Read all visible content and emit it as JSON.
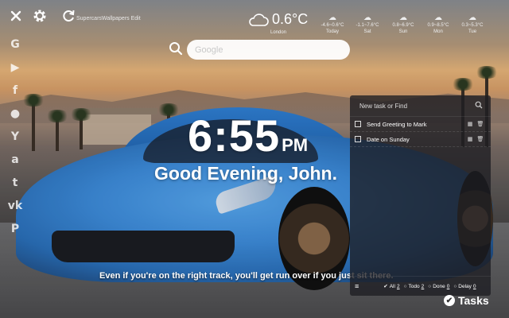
{
  "topbar": {
    "brand_text": "SupercarsWallpapers Edit"
  },
  "weather": {
    "current_temp": "0.6°C",
    "location": "London",
    "forecast": [
      {
        "range": "-4.6~0.6°C",
        "day": "Today"
      },
      {
        "range": "-1.1~7.6°C",
        "day": "Sat"
      },
      {
        "range": "0.8~6.9°C",
        "day": "Sun"
      },
      {
        "range": "0.9~8.5°C",
        "day": "Mon"
      },
      {
        "range": "0.3~5.3°C",
        "day": "Tue"
      }
    ]
  },
  "search": {
    "placeholder": "Google"
  },
  "social": [
    "G",
    "▶",
    "f",
    "●",
    "Y",
    "a",
    "t",
    "vk",
    "P"
  ],
  "clock": {
    "time": "6:55",
    "ampm": "PM"
  },
  "greeting": "Good Evening, John.",
  "quote": "Even if you're on the right track, you'll get run over if you just sit there.",
  "tasks": {
    "input_placeholder": "New task or Find",
    "items": [
      {
        "text": "Send Greeting to Mark"
      },
      {
        "text": "Date on Sunday"
      }
    ],
    "filters": [
      {
        "label": "All",
        "count": "2"
      },
      {
        "label": "Todo",
        "count": "2"
      },
      {
        "label": "Done",
        "count": "0"
      },
      {
        "label": "Delay",
        "count": "0"
      }
    ],
    "button_label": "Tasks"
  }
}
